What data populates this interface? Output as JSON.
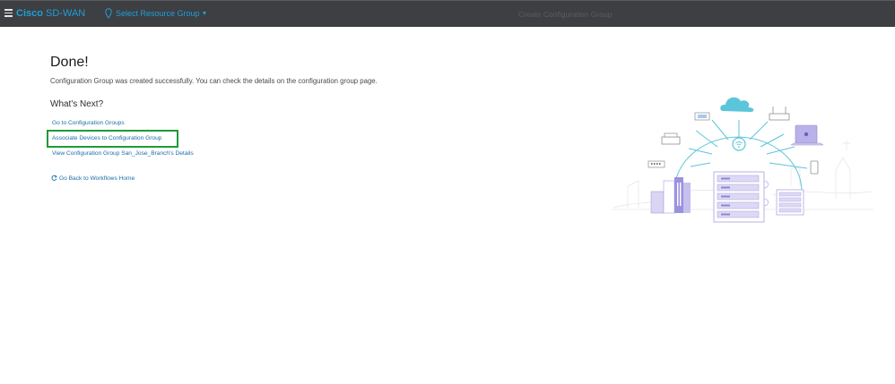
{
  "header": {
    "brand_strong": "Cisco",
    "brand_rest": " SD-WAN",
    "resource_group_label": "Select Resource Group",
    "page_title": "Create Configuration Group"
  },
  "main": {
    "title": "Done!",
    "message": "Configuration Group was created successfully. You can check the details on the configuration group page.",
    "next_heading": "What's Next?",
    "links": [
      "Go to Configuration Groups",
      "Associate Devices to Configuration Group",
      "View Configuration Group San_Jose_Branch's Details"
    ],
    "back_link": "Go Back to Workflows Home"
  },
  "colors": {
    "topbar": "#3d3f43",
    "brand": "#1e9fd8",
    "link": "#1b6ea8",
    "highlight": "#1f9a3a"
  },
  "icons": [
    "menu-icon",
    "location-pin-icon",
    "caret-down-icon",
    "refresh-icon"
  ]
}
